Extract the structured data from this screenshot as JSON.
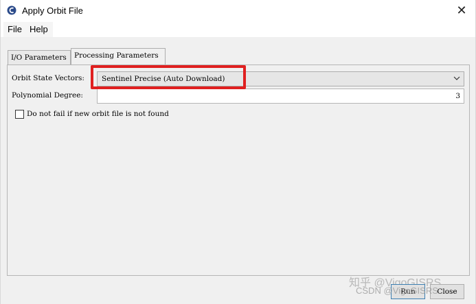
{
  "window": {
    "title": "Apply Orbit File",
    "close_glyph": "✕"
  },
  "menu": {
    "items": [
      {
        "label": "File"
      },
      {
        "label": "Help"
      }
    ]
  },
  "tabs": [
    {
      "label": "I/O Parameters",
      "active": false
    },
    {
      "label": "Processing Parameters",
      "active": true
    }
  ],
  "form": {
    "orbit_state_vectors": {
      "label": "Orbit State Vectors:",
      "value": "Sentinel Precise (Auto Download)"
    },
    "polynomial_degree": {
      "label": "Polynomial Degree:",
      "value": "3"
    },
    "do_not_fail": {
      "label": "Do not fail if new orbit file is not found",
      "checked": false
    }
  },
  "buttons": {
    "run": "Run",
    "close": "Close"
  },
  "watermarks": {
    "zhihu": "知乎 @VigoGISRS",
    "csdn": "CSDN @VigoGISRS"
  },
  "colors": {
    "highlight": "#e02020",
    "background": "#f0f0f0"
  },
  "icons": {
    "app": "snap-logo-icon",
    "close": "close-icon",
    "dropdown": "chevron-down-icon"
  }
}
